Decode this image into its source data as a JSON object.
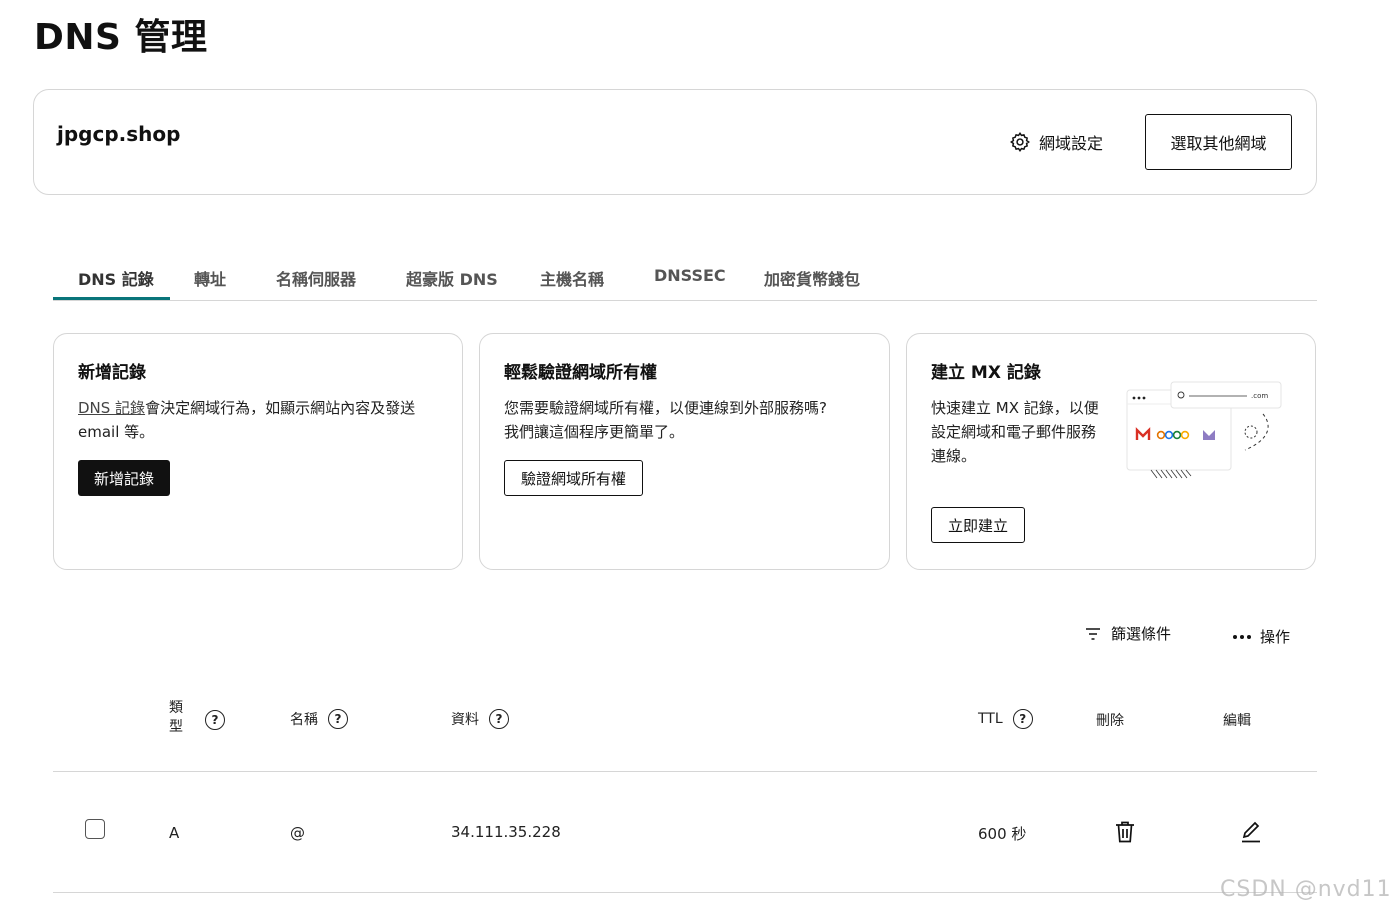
{
  "page": {
    "title": "DNS 管理"
  },
  "domain_card": {
    "domain": "jpgcp.shop",
    "settings_label": "網域設定",
    "select_other_label": "選取其他網域"
  },
  "tabs": [
    {
      "label": "DNS 記錄",
      "active": true
    },
    {
      "label": "轉址"
    },
    {
      "label": "名稱伺服器"
    },
    {
      "label": "超豪版 DNS"
    },
    {
      "label": "主機名稱"
    },
    {
      "label": "DNSSEC"
    },
    {
      "label": "加密貨幣錢包"
    }
  ],
  "cards": {
    "add_record": {
      "title": "新增記錄",
      "desc_link": "DNS 記錄",
      "desc_rest": "會決定網域行為，如顯示網站內容及發送",
      "desc_line2": "email 等。",
      "button": "新增記錄"
    },
    "verify": {
      "title": "輕鬆驗證網域所有權",
      "desc_line1": "您需要驗證網域所有權，以便連線到外部服務嗎?",
      "desc_line2": "我們讓這個程序更簡單了。",
      "button": "驗證網域所有權"
    },
    "mx": {
      "title": "建立 MX 記錄",
      "desc_line1": "快速建立 MX 記錄，以便",
      "desc_line2": "設定網域和電子郵件服務",
      "desc_line3": "連線。",
      "button": "立即建立",
      "illustration_url_suffix": ".com"
    }
  },
  "toolbar": {
    "filter_label": "篩選條件",
    "actions_label": "操作"
  },
  "table": {
    "headers": {
      "type": "類型",
      "name": "名稱",
      "data": "資料",
      "ttl": "TTL",
      "delete": "刪除",
      "edit": "編輯"
    },
    "rows": [
      {
        "type": "A",
        "name": "@",
        "data": "34.111.35.228",
        "ttl": "600 秒"
      }
    ]
  },
  "watermark": "CSDN @nvd11",
  "colors": {
    "accent": "#09757a",
    "primary_button": "#111111",
    "border": "#d6d6d6"
  }
}
